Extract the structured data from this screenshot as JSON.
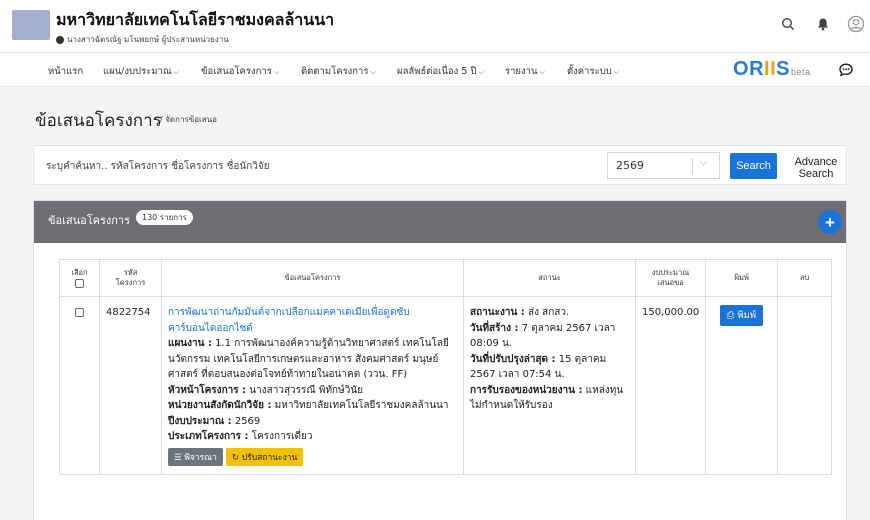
{
  "header": {
    "university_name": "มหาวิทยาลัยเทคโนโลยีราชมงคลล้านนา",
    "user_line": "นางสาวฉัตรณัฐ มโนพยกษ์ ผู้ประสานหน่วยงาน",
    "icons": [
      "search-icon",
      "bell-icon",
      "user-icon"
    ]
  },
  "nav": {
    "items": [
      {
        "label": "หน้าแรก",
        "has_caret": false
      },
      {
        "label": "แผน/งบประมาณ",
        "has_caret": true
      },
      {
        "label": "ข้อเสนอโครงการ",
        "has_caret": true
      },
      {
        "label": "ติดตามโครงการ",
        "has_caret": true
      },
      {
        "label": "ผลลัพธ์ต่อเนื่อง 5 ปี",
        "has_caret": true
      },
      {
        "label": "รายงาน",
        "has_caret": true
      },
      {
        "label": "ตั้งค่าระบบ",
        "has_caret": true
      }
    ],
    "brand": {
      "o": "O",
      "r": "R",
      "ii": "II",
      "s": "S",
      "beta": "beta"
    }
  },
  "page": {
    "title": "ข้อเสนอโครงการ",
    "breadcrumb": "/ จัดการข้อเสนอ"
  },
  "search": {
    "placeholder": "ระบุคำค้นหา.. รหัสโครงการ ชื่อโครงการ ชื่อนักวิจัย",
    "year": "2569",
    "search_label": "Search",
    "advance_label": "Advance Search"
  },
  "card": {
    "title": "ข้อเสนอโครงการ",
    "count": "130 รายการ",
    "add_label": "+"
  },
  "table": {
    "headers": {
      "select": "เลือก",
      "code_1": "รหัส",
      "code_2": "โครงการ",
      "proposal": "ข้อเสนอโครงการ",
      "status": "สถานะ",
      "budget_1": "งบประมาณ",
      "budget_2": "เสนอขอ",
      "print": "พิมพ์",
      "delete": "ลบ"
    },
    "rows": [
      {
        "code": "4822754",
        "title": "การพัฒนาถ่านกัมมันต์จากเปลือกแมคคาเดเมียเพื่อดูดซับคาร์บอนไดออกไซด์",
        "plan_label": "แผนงาน :",
        "plan_value": "1.1 การพัฒนาองค์ความรู้ด้านวิทยาศาสตร์ เทคโนโลยี นวัตกรรม เทคโนโลยีการเกษตรและอาหาร สังคมศาสตร์ มนุษย์ศาสตร์ ที่ตอบสนองต่อโจทย์ท้าทายในอนาคต (ววน. FF)",
        "head_label": "หัวหน้าโครงการ :",
        "head_value": "นางสาวสุวรรณี พิทักษ์วินัย",
        "unit_label": "หน่วยงานสังกัดนักวิจัย :",
        "unit_value": "มหาวิทยาลัยเทคโนโลยีราชมงคลล้านนา",
        "fy_label": "ปีงบประมาณ :",
        "fy_value": "2569",
        "type_label": "ประเภทโครงการ :",
        "type_value": "โครงการเดี่ยว",
        "consider_label": "พิจารณา",
        "update_label": "ปรับสถานะงาน",
        "status_label": "สถานะงาน :",
        "status_value": "ส่ง สกสว.",
        "created_label": "วันที่สร้าง :",
        "created_value": "7 ตุลาคม 2567 เวลา 08:09 น.",
        "updated_label": "วันที่ปรับปรุงล่าสุด :",
        "updated_value": "15 ตุลาคม 2567 เวลา 07:54 น.",
        "approval_label": "การรับรองของหน่วยงาน :",
        "approval_value": "แหล่งทุนไม่กำหนดให้รับรอง",
        "budget": "150,000.00",
        "print_label": "พิมพ์"
      }
    ]
  },
  "colors": {
    "primary": "#1a73d8",
    "card_header": "#6f6f73",
    "warning": "#f2c200",
    "secondary": "#6c757d",
    "brand_orange": "#e8a317"
  }
}
